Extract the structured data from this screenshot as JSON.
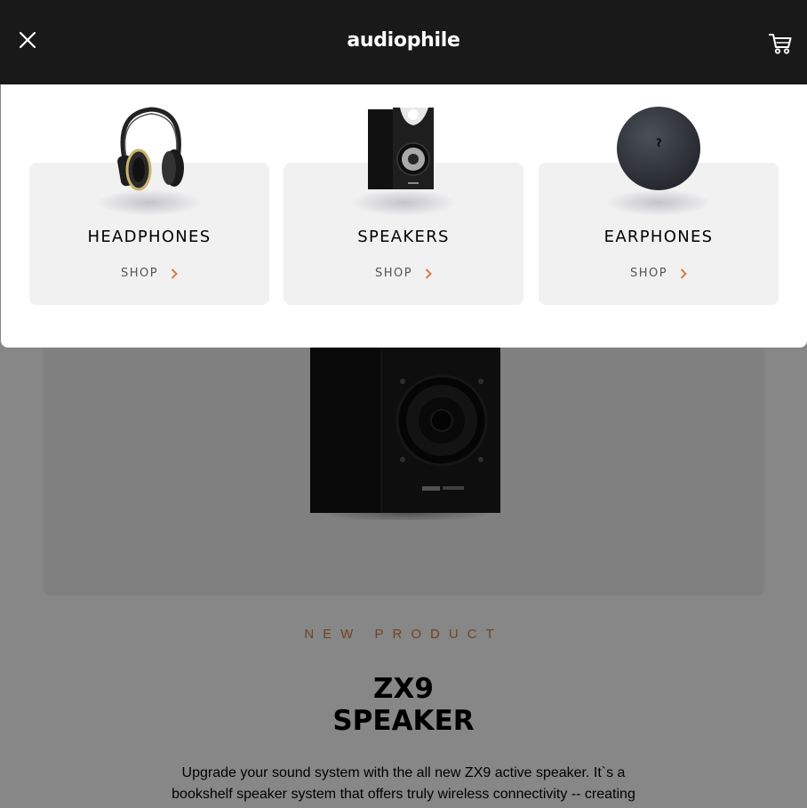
{
  "header": {
    "logo": "audiophile",
    "close_icon": "close-icon",
    "cart_icon": "cart-icon",
    "background": "#191919"
  },
  "menu": {
    "categories": [
      {
        "name": "HEADPHONES",
        "shop_label": "SHOP",
        "image": "headphones-image"
      },
      {
        "name": "SPEAKERS",
        "shop_label": "SHOP",
        "image": "speaker-image"
      },
      {
        "name": "EARPHONES",
        "shop_label": "SHOP",
        "image": "earphones-image"
      }
    ],
    "arrow_icon": "chevron-right-icon"
  },
  "hero": {
    "overline": "NEW PRODUCT",
    "title_line1": "ZX9",
    "title_line2": "SPEAKER",
    "description_line1": "Upgrade your sound system with the all new ZX9 active speaker. It`s a",
    "description_line2": "bookshelf speaker system that offers truly wireless connectivity -- creating"
  },
  "colors": {
    "accent": "#d87d4a",
    "card_bg": "#f1f1f1",
    "dark": "#191919"
  }
}
